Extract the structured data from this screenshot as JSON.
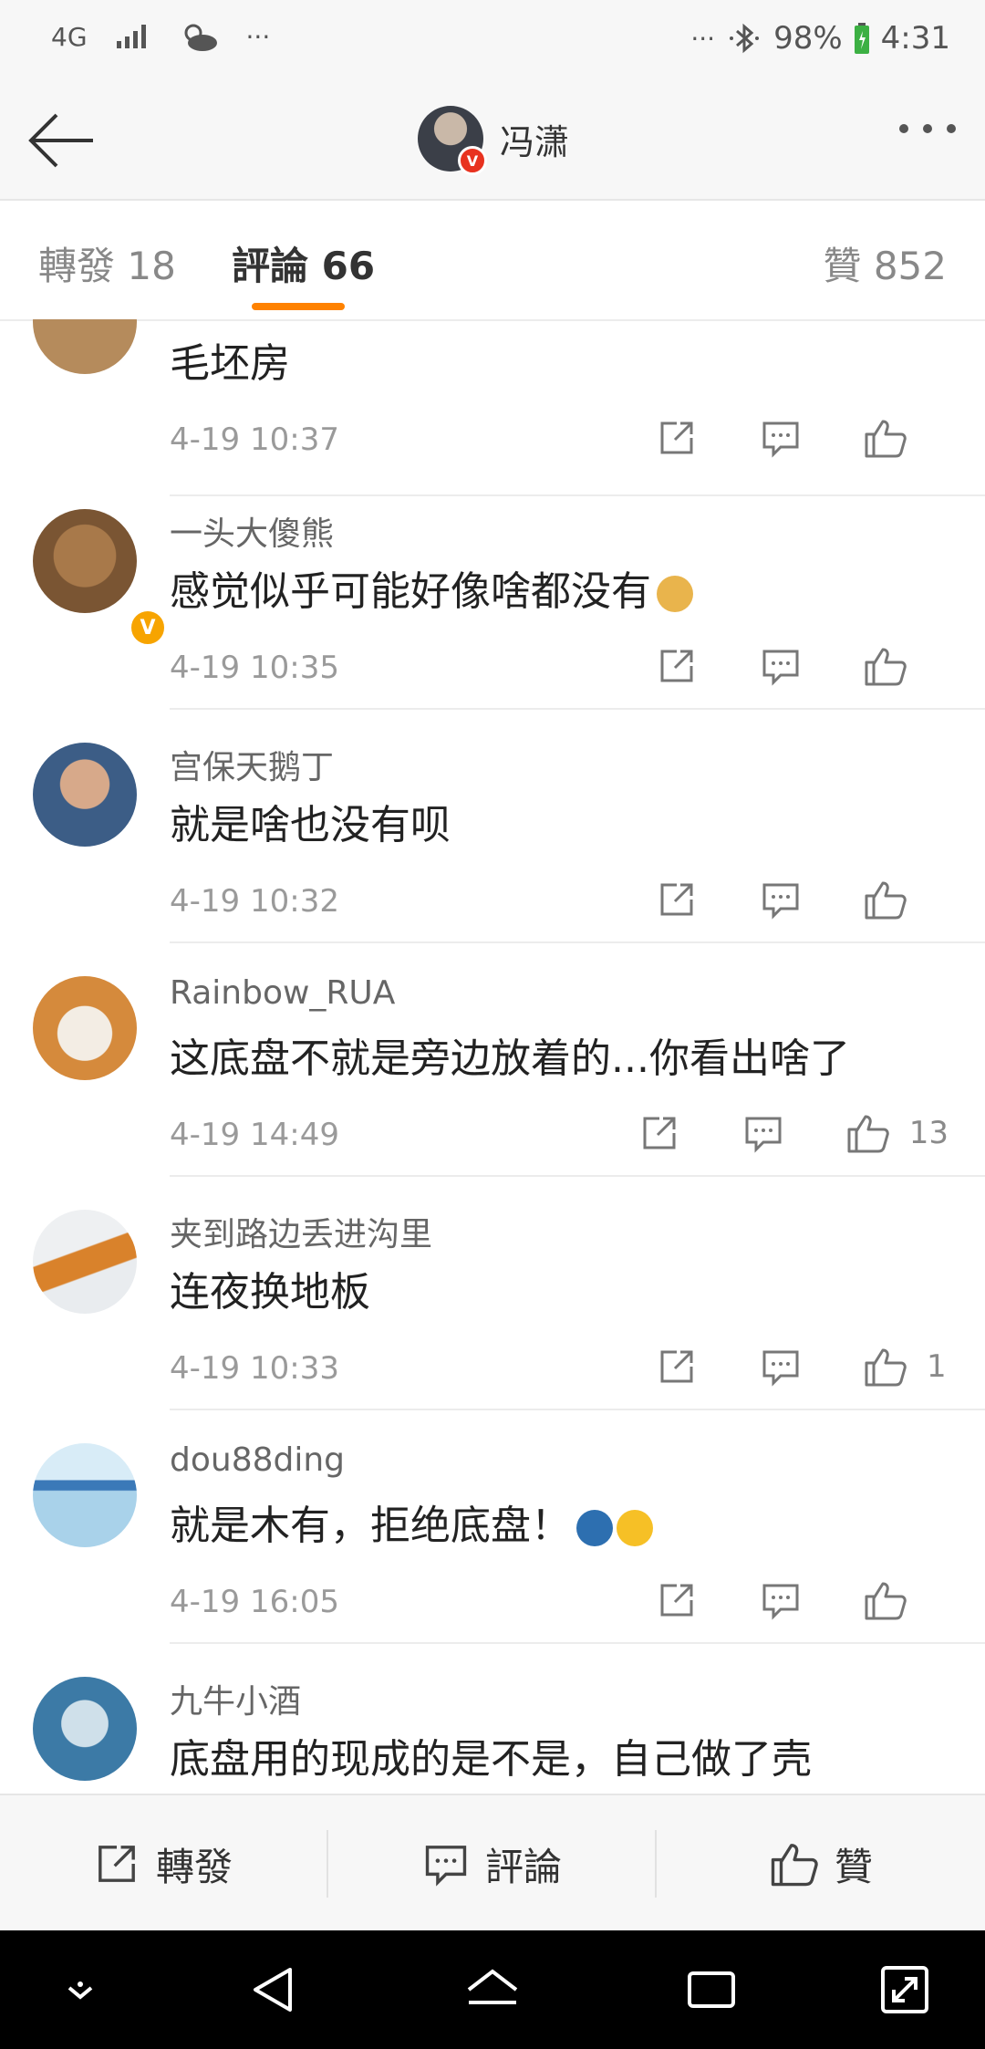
{
  "status_bar": {
    "network": "4G",
    "battery": "98%",
    "time": "4:31",
    "icons": [
      "signal-icon",
      "weather-icon",
      "more-dots-icon",
      "bluetooth-icon",
      "battery-icon"
    ]
  },
  "header": {
    "title": "冯潇",
    "badge": "V",
    "icons": [
      "back-arrow-icon",
      "more-icon"
    ]
  },
  "tabs": {
    "repost": "轉發 18",
    "comment": "評論 66",
    "like": "贊 852",
    "accent": "#ff8200"
  },
  "comments": [
    {
      "name": "",
      "text": "毛坯房",
      "time": "4-19 10:37",
      "likes": ""
    },
    {
      "name": "一头大傻熊",
      "text": "感觉似乎可能好像啥都没有",
      "emoji": "doge-emoji",
      "time": "4-19 10:35",
      "likes": ""
    },
    {
      "name": "宫保天鹅丁",
      "text": "就是啥也没有呗",
      "time": "4-19 10:32",
      "likes": ""
    },
    {
      "name": "Rainbow_RUA",
      "text": "这底盘不就是旁边放着的...你看出啥了",
      "time": "4-19 14:49",
      "likes": "13"
    },
    {
      "name": "夹到路边丢进沟里",
      "text": "连夜换地板",
      "time": "4-19 10:33",
      "likes": "1"
    },
    {
      "name": "dou88ding",
      "text": "就是木有，拒绝底盘！",
      "emoji": "laugh-cry-emoji",
      "time": "4-19 16:05",
      "likes": ""
    },
    {
      "name": "九牛小酒",
      "text": "底盘用的现成的是不是，自己做了壳",
      "time": "",
      "likes": ""
    }
  ],
  "bottom_bar": {
    "repost": "轉發",
    "comment": "評論",
    "like": "贊"
  },
  "nav_bar": {
    "icons": [
      "chevron-down-icon",
      "back-triangle-icon",
      "home-icon",
      "recents-icon",
      "expand-icon"
    ]
  }
}
